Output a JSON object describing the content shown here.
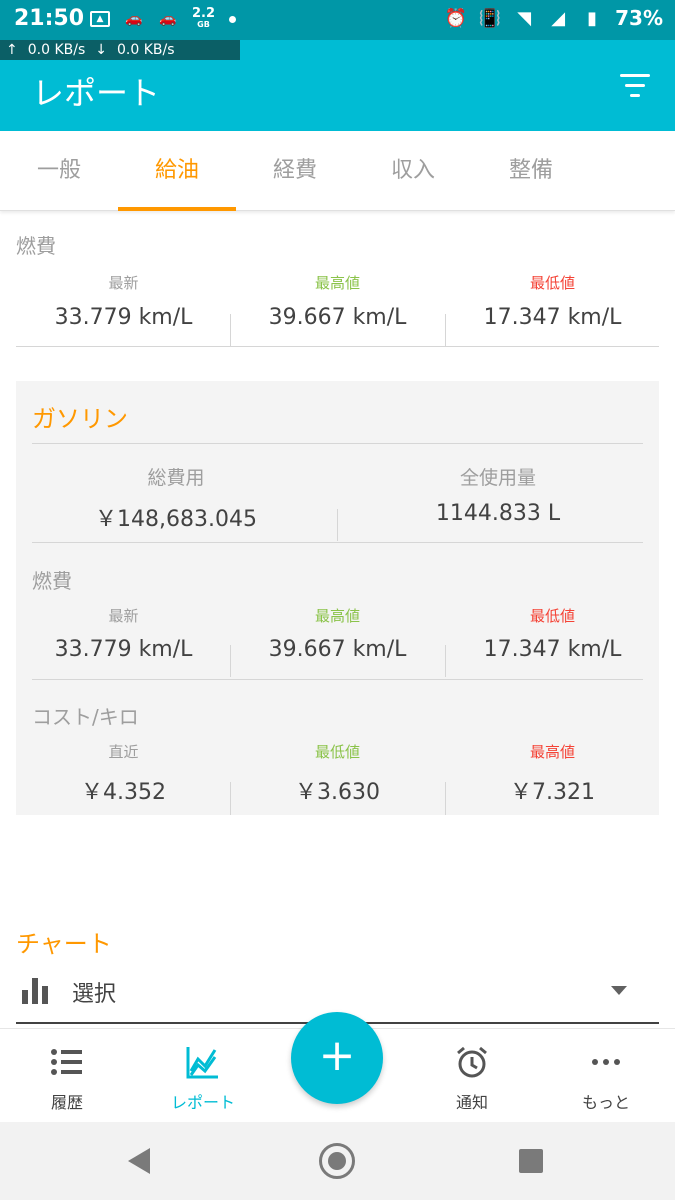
{
  "status_bar": {
    "time": "21:50",
    "data_gb": "2.2",
    "data_unit": "GB",
    "battery": "73%",
    "net_up": "0.0 KB/s",
    "net_down": "0.0 KB/s"
  },
  "appbar": {
    "title": "レポート",
    "filter_icon": "filter-icon"
  },
  "tabs": [
    {
      "label": "一般"
    },
    {
      "label": "給油",
      "active": true
    },
    {
      "label": "経費"
    },
    {
      "label": "収入"
    },
    {
      "label": "整備"
    }
  ],
  "fuel_efficiency": {
    "label": "燃費",
    "stats": [
      {
        "caption": "最新",
        "value": "33.779 km/L"
      },
      {
        "caption": "最高値",
        "value": "39.667 km/L"
      },
      {
        "caption": "最低値",
        "value": "17.347 km/L"
      }
    ]
  },
  "gasoline": {
    "title": "ガソリン",
    "total_cost_label": "総費用",
    "total_cost_value": "￥148,683.045",
    "total_volume_label": "全使用量",
    "total_volume_value": "1144.833 L",
    "efficiency": {
      "label": "燃費",
      "stats": [
        {
          "caption": "最新",
          "value": "33.779 km/L"
        },
        {
          "caption": "最高値",
          "value": "39.667 km/L"
        },
        {
          "caption": "最低値",
          "value": "17.347 km/L"
        }
      ]
    },
    "cost_per_km": {
      "label": "コスト/キロ",
      "stats": [
        {
          "caption": "直近",
          "value": "￥4.352"
        },
        {
          "caption": "最低値",
          "value": "￥3.630"
        },
        {
          "caption": "最高値",
          "value": "￥7.321"
        }
      ]
    }
  },
  "chart": {
    "title": "チャート",
    "select_label": "選択"
  },
  "bottom_nav": {
    "history": "履歴",
    "report": "レポート",
    "fab": "+",
    "notify": "通知",
    "more": "もっと"
  },
  "colors": {
    "primary": "#00bcd4",
    "accent": "#ff9800",
    "high": "#8bc34a",
    "low": "#f44336"
  }
}
